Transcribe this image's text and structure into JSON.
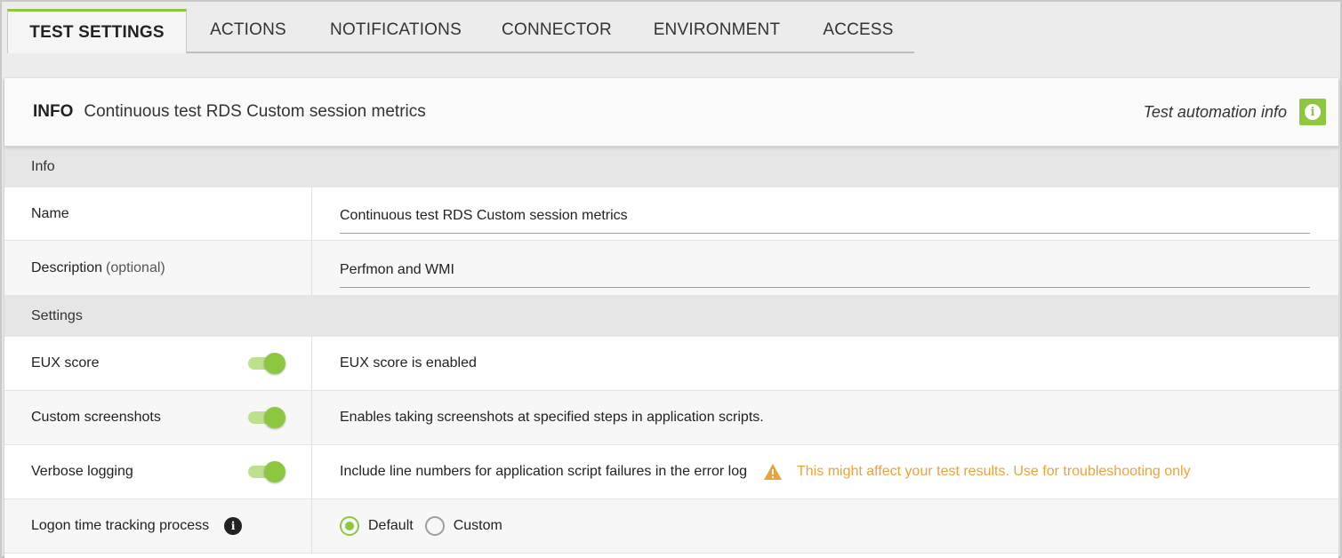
{
  "tabs": [
    {
      "label": "TEST SETTINGS",
      "active": true
    },
    {
      "label": "ACTIONS"
    },
    {
      "label": "NOTIFICATIONS"
    },
    {
      "label": "CONNECTOR"
    },
    {
      "label": "ENVIRONMENT"
    },
    {
      "label": "ACCESS"
    }
  ],
  "header": {
    "label": "INFO",
    "title": "Continuous test RDS Custom session metrics",
    "link": "Test automation info",
    "icon": "info-icon"
  },
  "sections": {
    "info": "Info",
    "settings": "Settings"
  },
  "fields": {
    "name_label": "Name",
    "name_value": "Continuous test RDS Custom session metrics",
    "description_label": "Description",
    "description_optional": "(optional)",
    "description_value": "Perfmon and WMI"
  },
  "settings": {
    "eux_label": "EUX score",
    "eux_desc": "EUX score is enabled",
    "eux_on": true,
    "screens_label": "Custom screenshots",
    "screens_desc": "Enables taking screenshots at specified steps in application scripts.",
    "screens_on": true,
    "verbose_label": "Verbose logging",
    "verbose_desc": "Include line numbers for application script failures in the error log",
    "verbose_warning": "This might affect your test results. Use for troubleshooting only",
    "verbose_on": true,
    "logon_label": "Logon time tracking process",
    "logon_opt_default": "Default",
    "logon_opt_custom": "Custom",
    "logon_selected": "Default"
  },
  "colors": {
    "accent": "#8dc63f",
    "warning": "#e8a33d"
  }
}
